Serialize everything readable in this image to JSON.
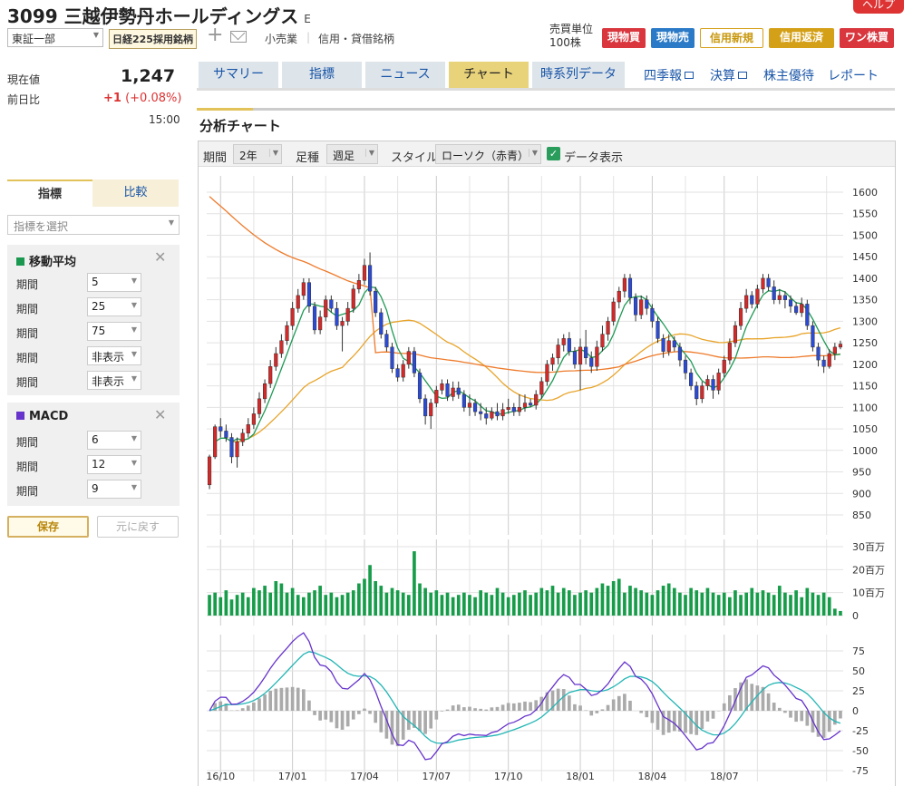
{
  "header": {
    "code_name": "3099 三越伊勢丹ホールディングス",
    "badge": "E",
    "help": "ヘルプ",
    "market": "東証一部",
    "index_badge": "日経225採用銘柄",
    "sector": "小売業",
    "margin_type": "信用・貸借銘柄",
    "unit_label": "売買単位",
    "unit_value": "100株",
    "buttons": [
      "現物買",
      "現物売",
      "信用新規",
      "信用返済",
      "ワン株買"
    ]
  },
  "quote": {
    "current_label": "現在値",
    "current": "1,247",
    "change_label": "前日比",
    "change": "+1",
    "change_pct": "(+0.08%)",
    "time": "15:00"
  },
  "left": {
    "tabs": [
      "指標",
      "比較"
    ],
    "select_placeholder": "指標を選択",
    "ma": {
      "title": "移動平均",
      "rows": [
        {
          "label": "期間",
          "value": "5"
        },
        {
          "label": "期間",
          "value": "25"
        },
        {
          "label": "期間",
          "value": "75"
        },
        {
          "label": "期間",
          "value": "非表示"
        },
        {
          "label": "期間",
          "value": "非表示"
        }
      ],
      "color": "#1a9850"
    },
    "macd": {
      "title": "MACD",
      "rows": [
        {
          "label": "期間",
          "value": "6"
        },
        {
          "label": "期間",
          "value": "12"
        },
        {
          "label": "期間",
          "value": "9"
        }
      ],
      "color": "#6633cc"
    },
    "save": "保存",
    "reset": "元に戻す"
  },
  "tabs": [
    "サマリー",
    "指標",
    "ニュース",
    "チャート",
    "時系列データ"
  ],
  "tab_links": [
    "四季報",
    "決算",
    "株主優待",
    "レポート"
  ],
  "section_title": "分析チャート",
  "controls": {
    "period_label": "期間",
    "period": "2年",
    "foot_label": "足種",
    "foot": "週足",
    "style_label": "スタイル",
    "style": "ローソク（赤青）",
    "data_label": "データ表示"
  },
  "chart_data": {
    "type": "candlestick",
    "x_ticks": [
      "16/10",
      "17/01",
      "17/04",
      "17/07",
      "17/10",
      "18/01",
      "18/04",
      "18/07"
    ],
    "price_ticks": [
      850,
      900,
      950,
      1000,
      1050,
      1100,
      1150,
      1200,
      1250,
      1300,
      1350,
      1400,
      1450,
      1500,
      1550,
      1600
    ],
    "volume_ticks": [
      "0",
      "10百万",
      "20百万",
      "30百万"
    ],
    "macd_ticks": [
      -75,
      -50,
      -25,
      0,
      25,
      50,
      75
    ],
    "candles": [
      [
        920,
        985,
        910,
        990
      ],
      [
        985,
        1055,
        980,
        1060
      ],
      [
        1055,
        1045,
        1030,
        1075
      ],
      [
        1045,
        1030,
        1020,
        1060
      ],
      [
        1030,
        985,
        970,
        1040
      ],
      [
        985,
        1020,
        960,
        1030
      ],
      [
        1020,
        1040,
        1010,
        1050
      ],
      [
        1040,
        1060,
        1030,
        1075
      ],
      [
        1060,
        1085,
        1050,
        1100
      ],
      [
        1085,
        1120,
        1075,
        1135
      ],
      [
        1120,
        1155,
        1110,
        1165
      ],
      [
        1155,
        1195,
        1145,
        1210
      ],
      [
        1195,
        1225,
        1185,
        1240
      ],
      [
        1225,
        1255,
        1215,
        1270
      ],
      [
        1255,
        1290,
        1245,
        1300
      ],
      [
        1290,
        1330,
        1280,
        1345
      ],
      [
        1330,
        1360,
        1320,
        1375
      ],
      [
        1360,
        1390,
        1350,
        1400
      ],
      [
        1390,
        1335,
        1320,
        1400
      ],
      [
        1335,
        1280,
        1270,
        1345
      ],
      [
        1280,
        1310,
        1270,
        1325
      ],
      [
        1310,
        1350,
        1300,
        1360
      ],
      [
        1350,
        1330,
        1320,
        1360
      ],
      [
        1330,
        1290,
        1280,
        1345
      ],
      [
        1290,
        1300,
        1230,
        1310
      ],
      [
        1300,
        1330,
        1290,
        1345
      ],
      [
        1330,
        1375,
        1320,
        1385
      ],
      [
        1375,
        1395,
        1365,
        1410
      ],
      [
        1395,
        1430,
        1385,
        1445
      ],
      [
        1430,
        1370,
        1360,
        1460
      ],
      [
        1370,
        1320,
        1310,
        1380
      ],
      [
        1320,
        1270,
        1260,
        1330
      ],
      [
        1270,
        1240,
        1230,
        1280
      ],
      [
        1240,
        1190,
        1180,
        1250
      ],
      [
        1190,
        1170,
        1160,
        1200
      ],
      [
        1170,
        1200,
        1160,
        1210
      ],
      [
        1200,
        1230,
        1190,
        1240
      ],
      [
        1230,
        1180,
        1170,
        1240
      ],
      [
        1180,
        1120,
        1110,
        1190
      ],
      [
        1120,
        1080,
        1060,
        1130
      ],
      [
        1080,
        1110,
        1050,
        1120
      ],
      [
        1110,
        1140,
        1100,
        1150
      ],
      [
        1140,
        1155,
        1130,
        1165
      ],
      [
        1155,
        1125,
        1115,
        1165
      ],
      [
        1125,
        1145,
        1115,
        1160
      ],
      [
        1145,
        1130,
        1120,
        1160
      ],
      [
        1130,
        1100,
        1090,
        1140
      ],
      [
        1100,
        1110,
        1080,
        1130
      ],
      [
        1110,
        1090,
        1080,
        1120
      ],
      [
        1090,
        1085,
        1070,
        1110
      ],
      [
        1085,
        1075,
        1060,
        1100
      ],
      [
        1075,
        1090,
        1070,
        1100
      ],
      [
        1090,
        1080,
        1070,
        1110
      ],
      [
        1080,
        1095,
        1070,
        1110
      ],
      [
        1095,
        1100,
        1085,
        1120
      ],
      [
        1100,
        1090,
        1080,
        1110
      ],
      [
        1090,
        1100,
        1080,
        1130
      ],
      [
        1100,
        1110,
        1090,
        1130
      ],
      [
        1110,
        1105,
        1100,
        1120
      ],
      [
        1105,
        1130,
        1095,
        1140
      ],
      [
        1130,
        1160,
        1120,
        1170
      ],
      [
        1160,
        1200,
        1150,
        1210
      ],
      [
        1200,
        1215,
        1185,
        1225
      ],
      [
        1215,
        1245,
        1200,
        1260
      ],
      [
        1245,
        1260,
        1230,
        1270
      ],
      [
        1260,
        1230,
        1220,
        1275
      ],
      [
        1230,
        1200,
        1190,
        1240
      ],
      [
        1200,
        1240,
        1140,
        1260
      ],
      [
        1240,
        1215,
        1200,
        1280
      ],
      [
        1215,
        1195,
        1180,
        1230
      ],
      [
        1195,
        1240,
        1185,
        1255
      ],
      [
        1240,
        1270,
        1230,
        1290
      ],
      [
        1270,
        1300,
        1255,
        1310
      ],
      [
        1300,
        1345,
        1290,
        1355
      ],
      [
        1345,
        1370,
        1330,
        1380
      ],
      [
        1370,
        1400,
        1355,
        1410
      ],
      [
        1400,
        1355,
        1340,
        1410
      ],
      [
        1355,
        1315,
        1300,
        1365
      ],
      [
        1315,
        1350,
        1305,
        1360
      ],
      [
        1350,
        1330,
        1315,
        1360
      ],
      [
        1330,
        1300,
        1285,
        1340
      ],
      [
        1300,
        1260,
        1250,
        1310
      ],
      [
        1260,
        1230,
        1215,
        1270
      ],
      [
        1230,
        1255,
        1220,
        1270
      ],
      [
        1255,
        1240,
        1230,
        1265
      ],
      [
        1240,
        1210,
        1195,
        1250
      ],
      [
        1210,
        1180,
        1165,
        1220
      ],
      [
        1180,
        1150,
        1140,
        1190
      ],
      [
        1150,
        1120,
        1105,
        1160
      ],
      [
        1120,
        1150,
        1110,
        1160
      ],
      [
        1150,
        1165,
        1140,
        1175
      ],
      [
        1165,
        1140,
        1120,
        1175
      ],
      [
        1140,
        1180,
        1130,
        1190
      ],
      [
        1180,
        1210,
        1170,
        1220
      ],
      [
        1210,
        1250,
        1200,
        1260
      ],
      [
        1250,
        1290,
        1240,
        1300
      ],
      [
        1290,
        1330,
        1280,
        1345
      ],
      [
        1330,
        1360,
        1320,
        1375
      ],
      [
        1360,
        1340,
        1330,
        1370
      ],
      [
        1340,
        1375,
        1330,
        1385
      ],
      [
        1375,
        1400,
        1365,
        1410
      ],
      [
        1400,
        1380,
        1370,
        1410
      ],
      [
        1380,
        1350,
        1340,
        1395
      ],
      [
        1350,
        1360,
        1340,
        1375
      ],
      [
        1360,
        1350,
        1330,
        1370
      ],
      [
        1350,
        1335,
        1320,
        1360
      ],
      [
        1335,
        1320,
        1315,
        1345
      ],
      [
        1320,
        1340,
        1310,
        1355
      ],
      [
        1340,
        1290,
        1280,
        1350
      ],
      [
        1290,
        1240,
        1230,
        1300
      ],
      [
        1240,
        1210,
        1195,
        1250
      ],
      [
        1210,
        1195,
        1180,
        1220
      ],
      [
        1195,
        1225,
        1190,
        1235
      ],
      [
        1225,
        1240,
        1210,
        1250
      ],
      [
        1240,
        1247,
        1235,
        1255
      ]
    ],
    "volume": [
      9,
      10,
      8,
      11,
      7,
      9,
      10,
      8,
      12,
      11,
      13,
      10,
      15,
      14,
      10,
      12,
      9,
      8,
      10,
      11,
      13,
      9,
      10,
      8,
      9,
      10,
      11,
      14,
      16,
      22,
      15,
      13,
      10,
      12,
      11,
      10,
      9,
      28,
      14,
      12,
      10,
      11,
      9,
      10,
      8,
      9,
      10,
      9,
      8,
      11,
      10,
      9,
      12,
      10,
      8,
      9,
      10,
      11,
      9,
      10,
      12,
      11,
      13,
      10,
      12,
      11,
      9,
      10,
      11,
      10,
      12,
      14,
      13,
      15,
      16,
      10,
      13,
      12,
      11,
      10,
      9,
      11,
      13,
      14,
      12,
      10,
      9,
      12,
      11,
      10,
      12,
      10,
      9,
      10,
      8,
      11,
      9,
      10,
      12,
      10,
      11,
      10,
      9,
      13,
      10,
      9,
      11,
      8,
      12,
      10,
      9,
      10,
      8,
      3,
      2
    ]
  }
}
